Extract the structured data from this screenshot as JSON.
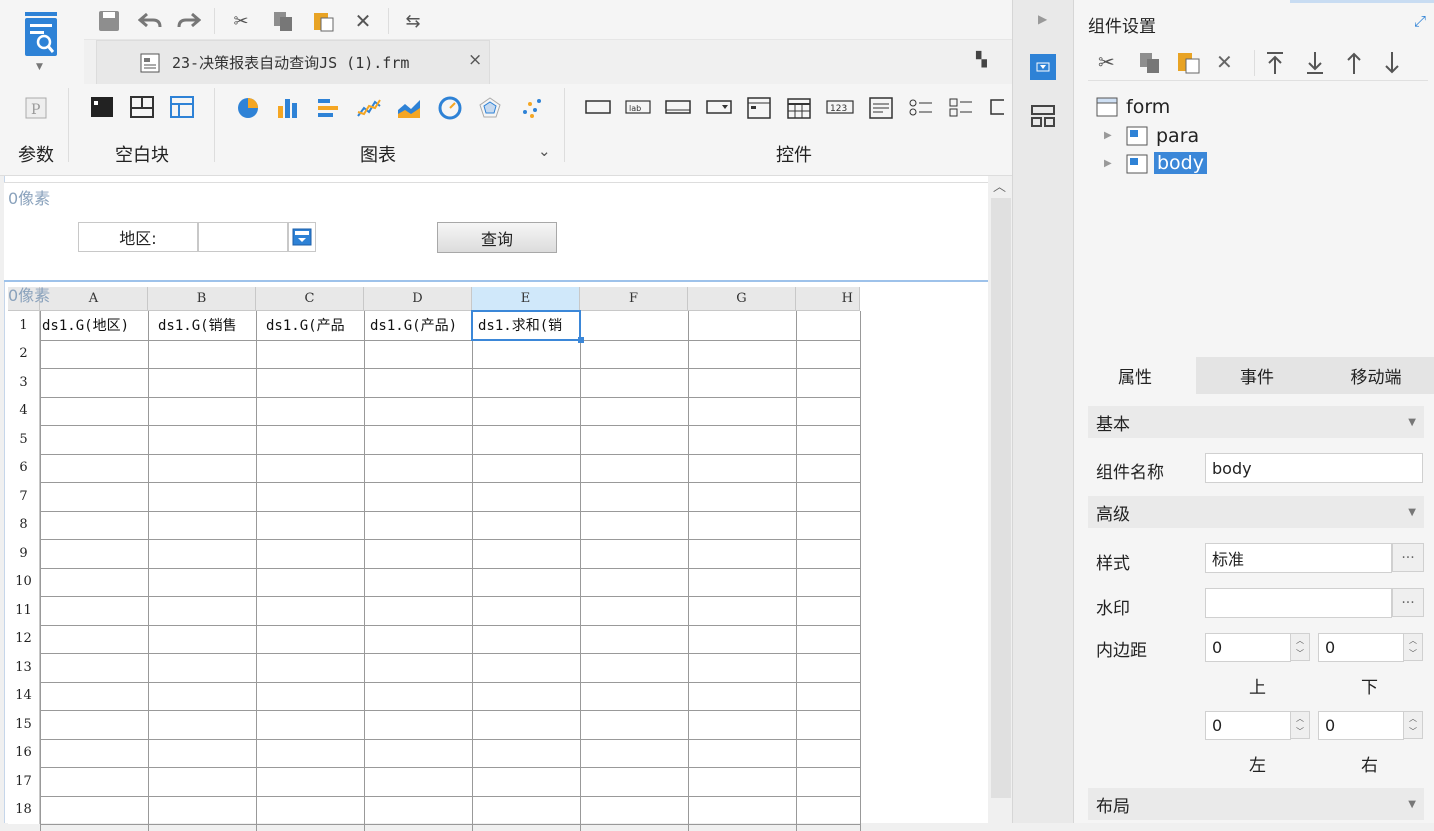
{
  "app": {
    "logo_icon": "report-designer-logo-icon"
  },
  "toolbar": {
    "icons": [
      "save-icon",
      "undo-icon",
      "redo-icon",
      "cut-icon",
      "copy-icon",
      "paste-icon",
      "delete-icon",
      "switch-icon"
    ]
  },
  "tab": {
    "label": "23-决策报表自动查询JS (1).frm",
    "close": "×"
  },
  "palette": {
    "groups": {
      "params": "参数",
      "blank": "空白块",
      "chart": "图表",
      "widgets": "控件"
    },
    "chart_expand": "⌄"
  },
  "canvas": {
    "para_pixel": "0像素",
    "body_pixel": "0像素",
    "region_label": "地区:",
    "region_value": "",
    "query_button": "查询"
  },
  "grid": {
    "columns": [
      "A",
      "B",
      "C",
      "D",
      "E",
      "F",
      "G",
      "H"
    ],
    "selected_column": "E",
    "rows": [
      "1",
      "2",
      "3",
      "4",
      "5",
      "6",
      "7",
      "8",
      "9",
      "10",
      "11",
      "12",
      "13",
      "14",
      "15",
      "16",
      "17",
      "18"
    ],
    "row1": [
      "ds1.G(地区)",
      "ds1.G(销售",
      "ds1.G(产品",
      "ds1.G(产品)",
      "ds1.求和(销"
    ]
  },
  "right_panel": {
    "title": "组件设置",
    "tree": {
      "root": "form",
      "children": [
        "para",
        "body"
      ],
      "selected": "body"
    },
    "tabs": [
      "属性",
      "事件",
      "移动端"
    ],
    "active_tab": "属性",
    "sections": {
      "basic": "基本",
      "advanced": "高级",
      "layout": "布局"
    },
    "name_label": "组件名称",
    "name_value": "body",
    "style_label": "样式",
    "style_value": "标准",
    "watermark_label": "水印",
    "watermark_value": "",
    "padding_label": "内边距",
    "padding": {
      "top": "0",
      "bottom": "0",
      "left": "0",
      "right": "0"
    },
    "padding_dirs": {
      "top": "上",
      "bottom": "下",
      "left": "左",
      "right": "右"
    },
    "more": "···"
  },
  "colors": {
    "accent": "#2e82d6",
    "selection": "#3b87d8",
    "header_sel": "#d0e8fa"
  }
}
